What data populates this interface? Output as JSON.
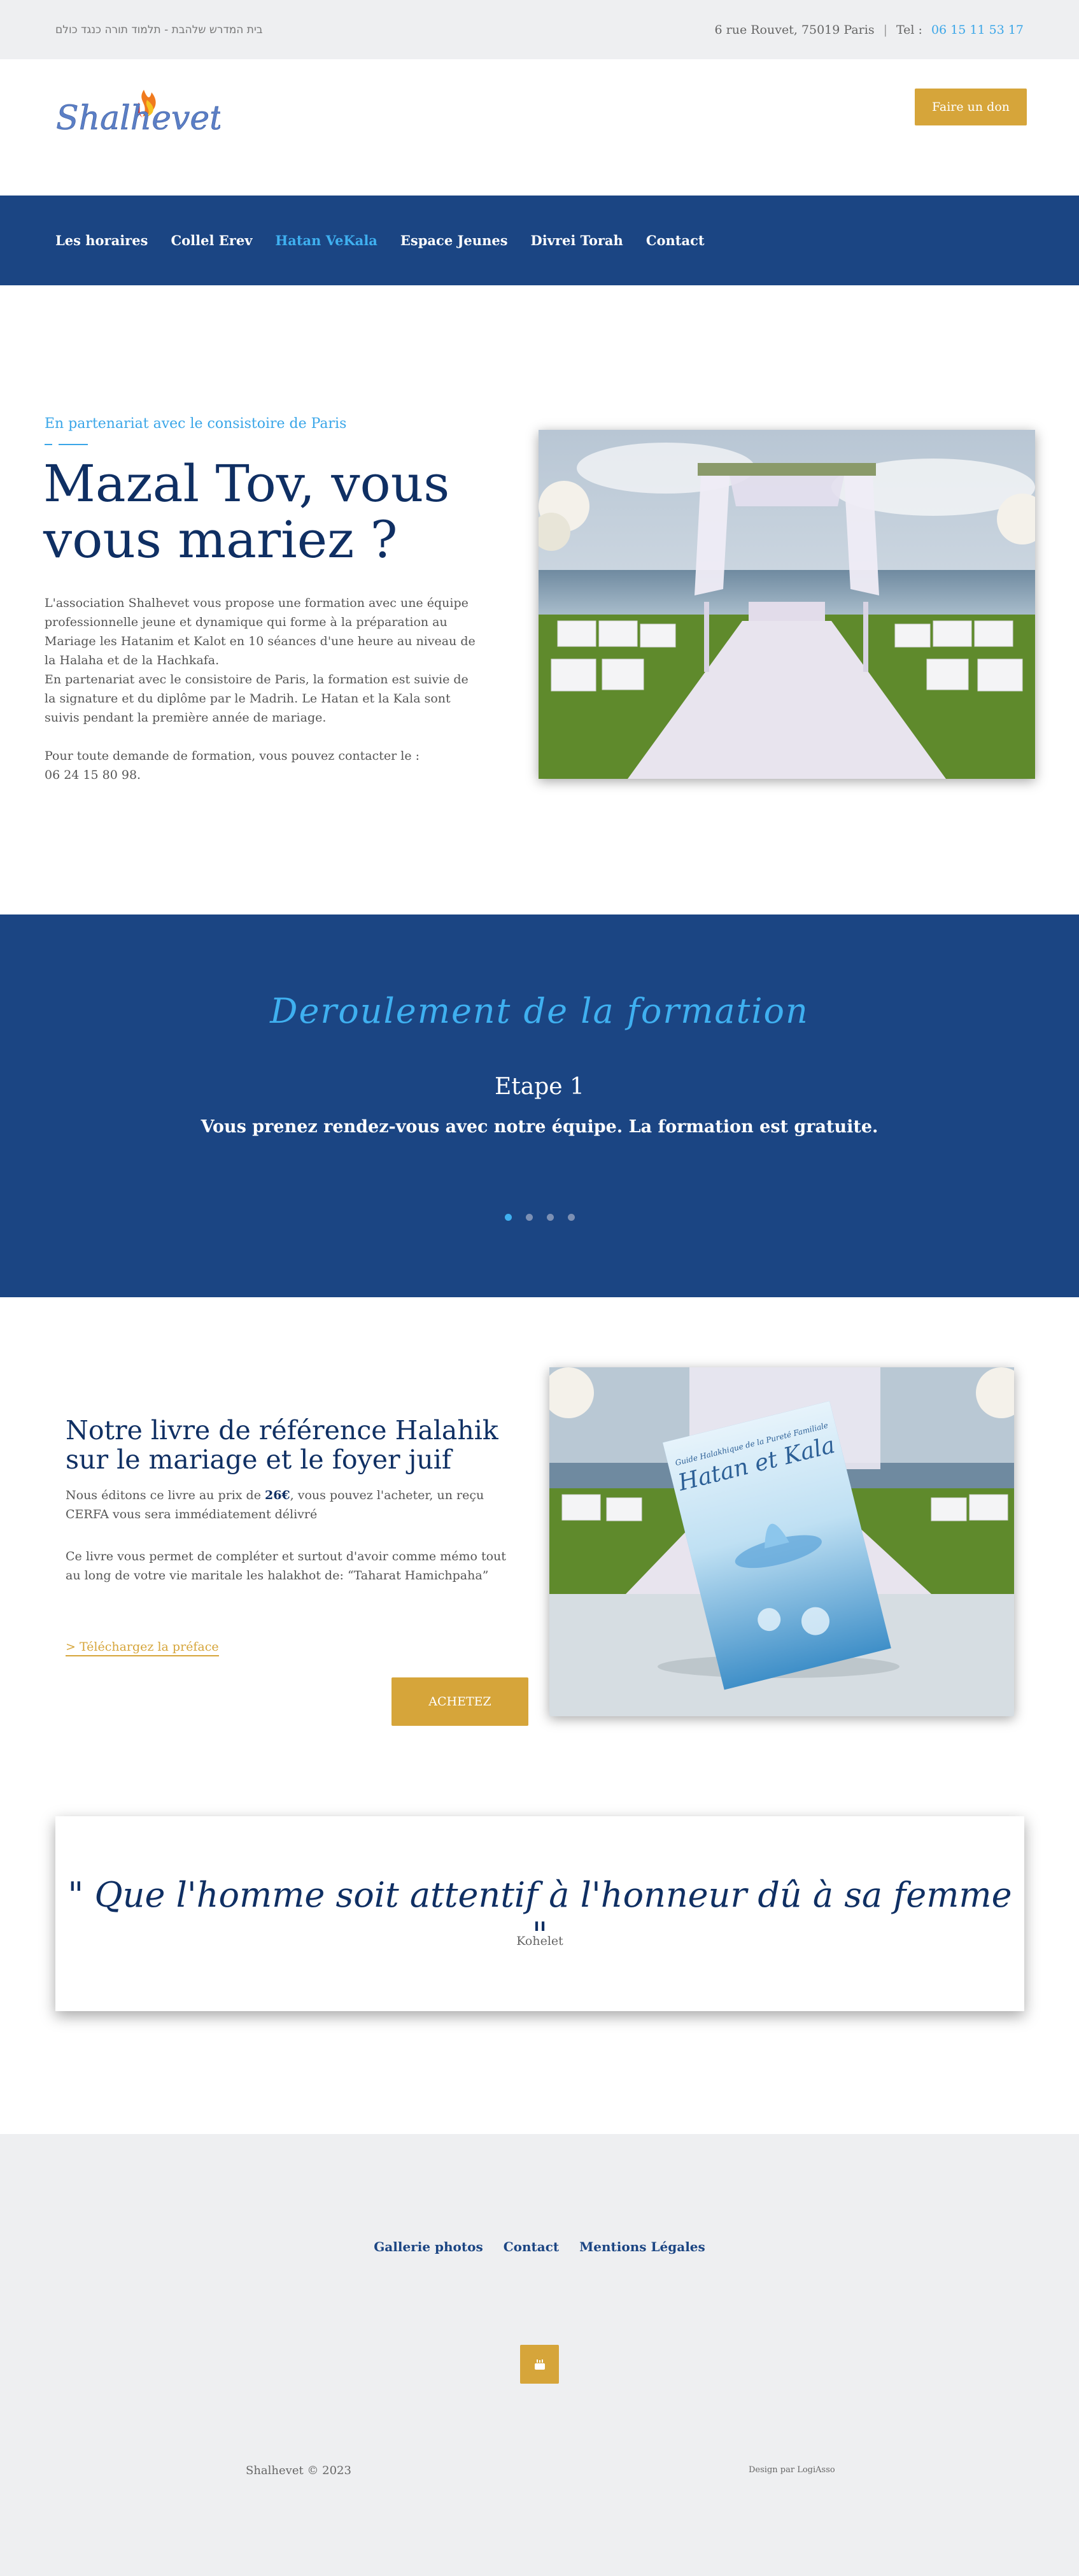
{
  "topbar": {
    "hebrew": "בית המדרש שלהבת - תלמוד תורה כנגד כולם",
    "address": "6 rue Rouvet, 75019 Paris",
    "separator": "|",
    "tel_label": "Tel :",
    "tel_value": "06 15 11 53 17"
  },
  "header": {
    "logo_text": "Shalhevet.fr",
    "donate_label": "Faire un don"
  },
  "nav": {
    "items": [
      "Les horaires",
      "Collel Erev",
      "Hatan VeKala",
      "Espace Jeunes",
      "Divrei Torah",
      "Contact"
    ]
  },
  "hero": {
    "kicker": "En partenariat avec le consistoire de Paris",
    "title": "Mazal Tov, vous vous mariez ?",
    "p1": "L'association Shalhevet vous propose une formation avec une équipe professionnelle jeune et dynamique qui forme à la préparation au Mariage les Hatanim et Kalot en 10 séances d'une heure au niveau de la Halaha et de la Hachkafa.",
    "p2": "En partenariat avec le consistoire de Paris, la formation est suivie de la signature et du diplôme par le Madrih. Le Hatan et la Kala sont suivis pendant la première année de mariage.",
    "p3": "Pour toute demande de formation, vous pouvez contacter le :",
    "p4": "06 24 15 80 98."
  },
  "formation": {
    "title": "Deroulement de la formation",
    "step": "Etape 1",
    "desc": "Vous prenez rendez-vous avec notre équipe. La formation est gratuite.",
    "slides": 4,
    "active_slide": 1
  },
  "book": {
    "title": "Notre livre de référence Halahik sur le mariage et le foyer juif",
    "p1_before": "Nous éditons ce livre au prix de ",
    "p1_price": "26€",
    "p1_after": ", vous pouvez l'acheter, un reçu CERFA vous sera immédiatement délivré",
    "p2": "Ce livre vous permet de compléter et surtout d'avoir comme mémo tout au long de votre vie maritale les halakhot de: “Taharat Hamichpaha”",
    "link": "> Téléchargez la préface",
    "buy_label": "ACHETEZ",
    "cover_small": "Guide Halakhique de la Pureté Familiale",
    "cover_title": "Hatan et Kala"
  },
  "quote": {
    "text": "\" Que l'homme soit attentif à l'honneur dû à sa femme \"",
    "author": "Kohelet"
  },
  "footer": {
    "links": [
      "Gallerie photos",
      "Contact",
      "Mentions Légales"
    ],
    "copyright": "Shalhevet © 2023",
    "design": "Design par LogiAsso"
  }
}
